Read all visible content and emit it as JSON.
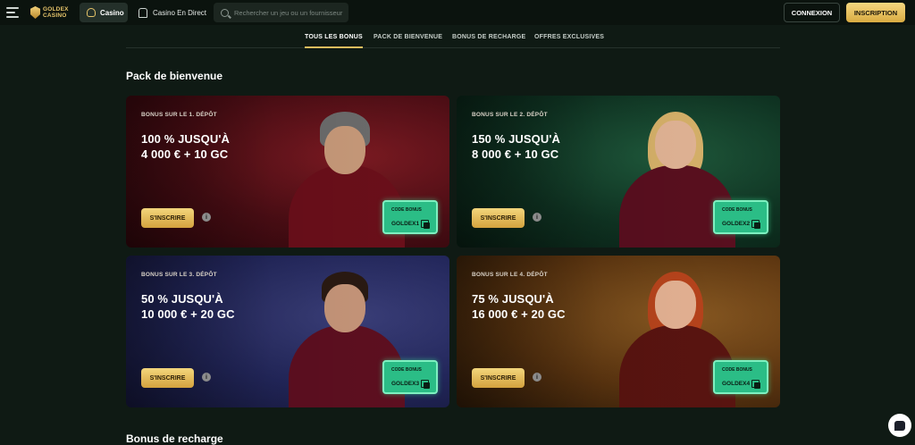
{
  "topbar": {
    "logo_line1": "GOLDEX",
    "logo_line2": "CASINO",
    "nav": [
      {
        "label": "Casino",
        "active": true
      },
      {
        "label": "Casino En Direct",
        "active": false
      }
    ],
    "search_placeholder": "Rechercher un jeu ou un fournisseur",
    "login_label": "CONNEXION",
    "signup_label": "INSCRIPTION"
  },
  "tabs": [
    {
      "label": "TOUS LES BONUS",
      "active": true
    },
    {
      "label": "PACK DE BIENVENUE",
      "active": false
    },
    {
      "label": "BONUS DE RECHARGE",
      "active": false
    },
    {
      "label": "OFFRES EXCLUSIVES",
      "active": false
    }
  ],
  "sections": {
    "welcome_title": "Pack de bienvenue",
    "reload_title": "Bonus de recharge"
  },
  "cards": [
    {
      "tag": "BONUS SUR LE 1. DÉPÔT",
      "line1": "100 % JUSQU'À",
      "line2": "4 000 € + 10 GC",
      "cta": "S'INSCRIRE",
      "code_label": "CODE BONUS",
      "code": "GOLDEX1"
    },
    {
      "tag": "BONUS SUR LE 2. DÉPÔT",
      "line1": "150 % JUSQU'À",
      "line2": "8 000 € + 10 GC",
      "cta": "S'INSCRIRE",
      "code_label": "CODE BONUS",
      "code": "GOLDEX2"
    },
    {
      "tag": "BONUS SUR LE 3. DÉPÔT",
      "line1": "50 % JUSQU'À",
      "line2": "10 000 € + 20 GC",
      "cta": "S'INSCRIRE",
      "code_label": "CODE BONUS",
      "code": "GOLDEX3"
    },
    {
      "tag": "BONUS SUR LE 4. DÉPÔT",
      "line1": "75 % JUSQU'À",
      "line2": "16 000 € + 20 GC",
      "cta": "S'INSCRIRE",
      "code_label": "CODE BONUS",
      "code": "GOLDEX4"
    }
  ],
  "info_glyph": "i",
  "colors": {
    "accent_gold": "#e2bd5e",
    "code_green": "#2bbd86",
    "background": "#0f1a14"
  }
}
